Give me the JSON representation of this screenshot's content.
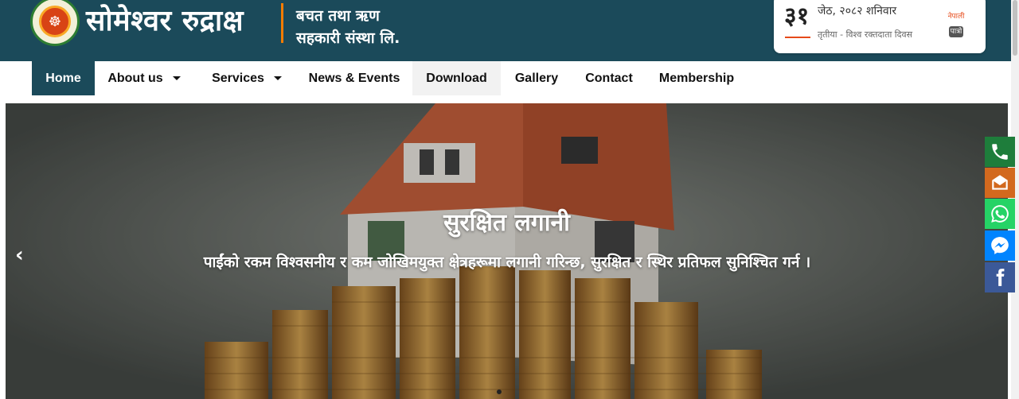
{
  "header": {
    "brand_name": "सोमेश्वर रुद्राक्ष",
    "brand_sub_1": "बचत तथा ऋण",
    "brand_sub_2": "सहकारी संस्था लि."
  },
  "date_widget": {
    "day": "३१",
    "date_text": "जेठ, २०८२ शनिवार",
    "sub_text": "तृतीया - विश्व रक्तदाता दिवस",
    "badge_top": "नेपाली",
    "badge_bottom": "पात्रो"
  },
  "nav": {
    "items": [
      {
        "label": "Home",
        "active": true
      },
      {
        "label": "About us",
        "dropdown": true
      },
      {
        "label": "Services",
        "dropdown": true
      },
      {
        "label": "News & Events"
      },
      {
        "label": "Download",
        "hover": true
      },
      {
        "label": "Gallery"
      },
      {
        "label": "Contact"
      },
      {
        "label": "Membership"
      }
    ]
  },
  "slider": {
    "title": "सुरक्षित लगानी",
    "description": "पाईंको रकम विश्वसनीय र कम जोखिमयुक्त क्षेत्रहरूमा लगानी गरिन्छ, सुरक्षित र स्थिर प्रतिफल सुनिश्चित गर्न ।",
    "prev_arrow": "‹"
  },
  "social": [
    {
      "icon": "phone-icon",
      "color": "#1e7d3b"
    },
    {
      "icon": "email-icon",
      "color": "#d2691e"
    },
    {
      "icon": "whatsapp-icon",
      "color": "#25d366"
    },
    {
      "icon": "messenger-icon",
      "color": "#0084ff"
    },
    {
      "icon": "facebook-icon",
      "color": "#3b5998"
    }
  ],
  "colors": {
    "header_bg": "#1b4a5a",
    "accent": "#f57c00"
  }
}
